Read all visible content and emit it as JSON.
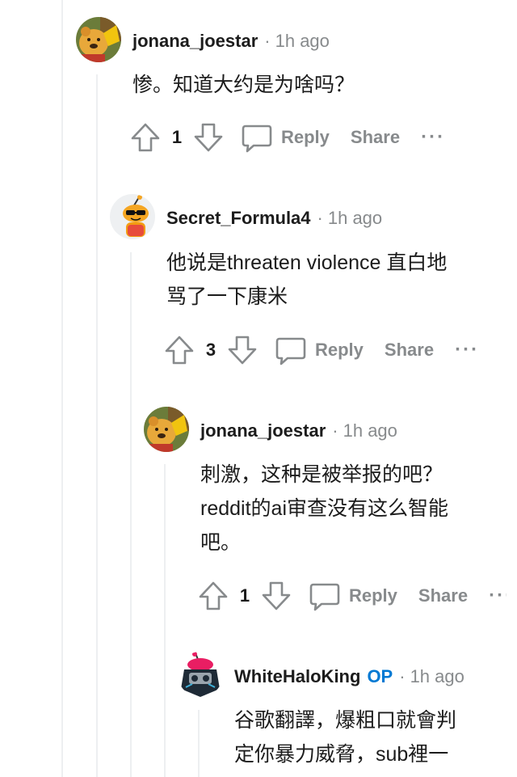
{
  "comments": [
    {
      "username": "jonana_joestar",
      "op": false,
      "time": "1h ago",
      "lines": [
        "惨。知道大约是为啥吗？"
      ],
      "score": "1",
      "reply_label": "Reply",
      "share_label": "Share",
      "avatar": "winnie-the-pooh-avatar"
    },
    {
      "username": "Secret_Formula4",
      "op": false,
      "time": "1h ago",
      "lines": [
        "他说是threaten violence 直白地",
        "骂了一下康米"
      ],
      "score": "3",
      "reply_label": "Reply",
      "share_label": "Share",
      "avatar": "snoo-sunglasses-avatar"
    },
    {
      "username": "jonana_joestar",
      "op": false,
      "time": "1h ago",
      "lines": [
        "刺激，这种是被举报的吧？",
        "reddit的ai审查没有这么智能",
        "吧。"
      ],
      "score": "1",
      "reply_label": "Reply",
      "share_label": "Share",
      "avatar": "winnie-the-pooh-avatar"
    },
    {
      "username": "WhiteHaloKing",
      "op": true,
      "op_label": "OP",
      "time": "1h ago",
      "lines": [
        "谷歌翻譯，爆粗口就會判",
        "定你暴力威脅，sub裡一"
      ],
      "avatar": "snoo-helmet-avatar"
    }
  ],
  "separator": "·",
  "colors": {
    "meta_gray": "#878a8c",
    "op_blue": "#0079d3",
    "thread_line": "#edeff1"
  }
}
